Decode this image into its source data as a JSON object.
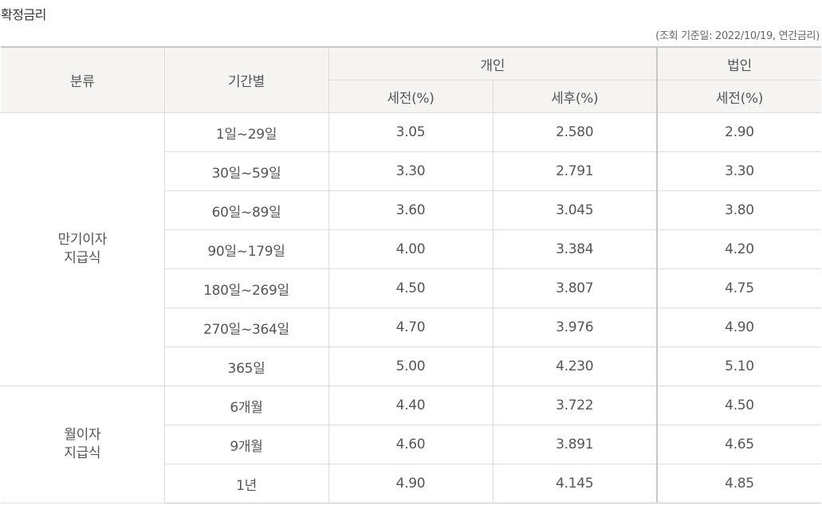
{
  "title": "확정금리",
  "note": "(조회 기준일: 2022/10/19, 연간금리)",
  "table": {
    "headers": {
      "category": "분류",
      "period": "기간별",
      "individual": "개인",
      "corporate": "법인",
      "pre_tax": "세전(%)",
      "post_tax": "세후(%)",
      "corp_pre_tax": "세전(%)"
    },
    "groups": [
      {
        "label_line1": "만기이자",
        "label_line2": "지급식",
        "rows": [
          {
            "period": "1일~29일",
            "pre_tax": "3.05",
            "post_tax": "2.580",
            "corp_pre_tax": "2.90"
          },
          {
            "period": "30일~59일",
            "pre_tax": "3.30",
            "post_tax": "2.791",
            "corp_pre_tax": "3.30"
          },
          {
            "period": "60일~89일",
            "pre_tax": "3.60",
            "post_tax": "3.045",
            "corp_pre_tax": "3.80"
          },
          {
            "period": "90일~179일",
            "pre_tax": "4.00",
            "post_tax": "3.384",
            "corp_pre_tax": "4.20"
          },
          {
            "period": "180일~269일",
            "pre_tax": "4.50",
            "post_tax": "3.807",
            "corp_pre_tax": "4.75"
          },
          {
            "period": "270일~364일",
            "pre_tax": "4.70",
            "post_tax": "3.976",
            "corp_pre_tax": "4.90"
          },
          {
            "period": "365일",
            "pre_tax": "5.00",
            "post_tax": "4.230",
            "corp_pre_tax": "5.10"
          }
        ]
      },
      {
        "label_line1": "월이자",
        "label_line2": "지급식",
        "rows": [
          {
            "period": "6개월",
            "pre_tax": "4.40",
            "post_tax": "3.722",
            "corp_pre_tax": "4.50"
          },
          {
            "period": "9개월",
            "pre_tax": "4.60",
            "post_tax": "3.891",
            "corp_pre_tax": "4.65"
          },
          {
            "period": "1년",
            "pre_tax": "4.90",
            "post_tax": "4.145",
            "corp_pre_tax": "4.85"
          }
        ]
      }
    ]
  }
}
